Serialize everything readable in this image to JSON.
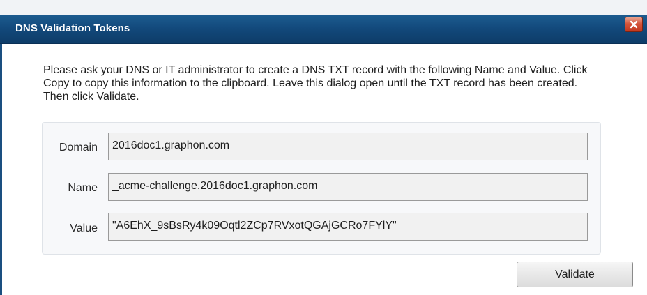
{
  "window": {
    "title": "DNS Validation Tokens",
    "close_icon": "close-icon"
  },
  "instructions": "Please ask your DNS or IT administrator to create a DNS TXT record with the following Name and Value. Click Copy to copy this information to the clipboard. Leave this dialog open until the TXT record has been created. Then click Validate.",
  "fields": [
    {
      "label": "Domain",
      "value": "2016doc1.graphon.com"
    },
    {
      "label": "Name",
      "value": "_acme-challenge.2016doc1.graphon.com"
    },
    {
      "label": "Value",
      "value": "\"A6EhX_9sBsRy4k09Oqtl2ZCp7RVxotQGAjGCRo7FYlY\""
    }
  ],
  "buttons": {
    "validate_label": "Validate"
  },
  "colors": {
    "titlebar": "#12487a",
    "close_button": "#d4553b",
    "group_background": "#f7f8fa",
    "field_background": "#f1f1f1"
  }
}
